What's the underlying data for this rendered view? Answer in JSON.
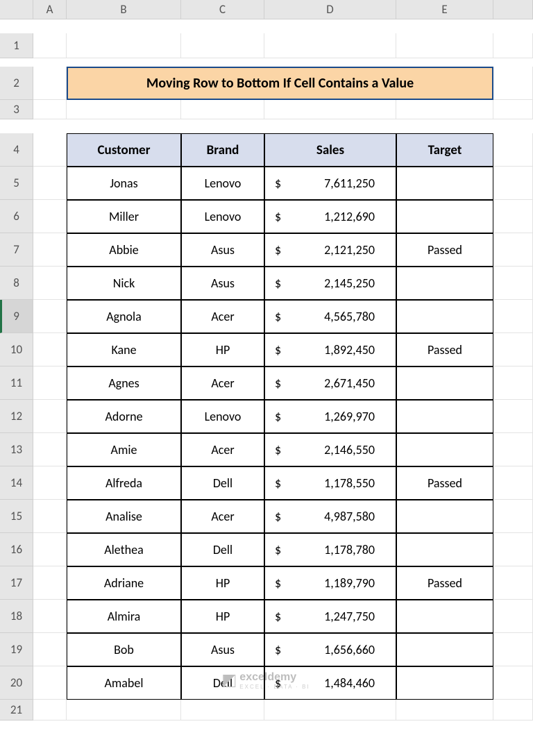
{
  "columns": [
    "A",
    "B",
    "C",
    "D",
    "E"
  ],
  "row_count": 21,
  "active_row": 9,
  "title": "Moving Row to Bottom If Cell Contains a Value",
  "headers": {
    "customer": "Customer",
    "brand": "Brand",
    "sales": "Sales",
    "target": "Target"
  },
  "currency_symbol": "$",
  "rows": [
    {
      "customer": "Jonas",
      "brand": "Lenovo",
      "sales": "7,611,250",
      "target": ""
    },
    {
      "customer": "Miller",
      "brand": "Lenovo",
      "sales": "1,212,690",
      "target": ""
    },
    {
      "customer": "Abbie",
      "brand": "Asus",
      "sales": "2,121,250",
      "target": "Passed"
    },
    {
      "customer": "Nick",
      "brand": "Asus",
      "sales": "2,145,250",
      "target": ""
    },
    {
      "customer": "Agnola",
      "brand": "Acer",
      "sales": "4,565,780",
      "target": ""
    },
    {
      "customer": "Kane",
      "brand": "HP",
      "sales": "1,892,450",
      "target": "Passed"
    },
    {
      "customer": "Agnes",
      "brand": "Acer",
      "sales": "2,671,450",
      "target": ""
    },
    {
      "customer": "Adorne",
      "brand": "Lenovo",
      "sales": "1,269,970",
      "target": ""
    },
    {
      "customer": "Amie",
      "brand": "Acer",
      "sales": "2,146,550",
      "target": ""
    },
    {
      "customer": "Alfreda",
      "brand": "Dell",
      "sales": "1,178,550",
      "target": "Passed"
    },
    {
      "customer": "Analise",
      "brand": "Acer",
      "sales": "4,987,580",
      "target": ""
    },
    {
      "customer": "Alethea",
      "brand": "Dell",
      "sales": "1,178,780",
      "target": ""
    },
    {
      "customer": "Adriane",
      "brand": "HP",
      "sales": "1,189,790",
      "target": "Passed"
    },
    {
      "customer": "Almira",
      "brand": "HP",
      "sales": "1,247,750",
      "target": ""
    },
    {
      "customer": "Bob",
      "brand": "Asus",
      "sales": "1,656,660",
      "target": ""
    },
    {
      "customer": "Amabel",
      "brand": "Dell",
      "sales": "1,484,460",
      "target": ""
    }
  ],
  "watermark": {
    "brand": "exceldemy",
    "tagline": "EXCEL · DATA · BI"
  },
  "chart_data": {
    "type": "table",
    "title": "Moving Row to Bottom If Cell Contains a Value",
    "columns": [
      "Customer",
      "Brand",
      "Sales",
      "Target"
    ],
    "data": [
      [
        "Jonas",
        "Lenovo",
        7611250,
        ""
      ],
      [
        "Miller",
        "Lenovo",
        1212690,
        ""
      ],
      [
        "Abbie",
        "Asus",
        2121250,
        "Passed"
      ],
      [
        "Nick",
        "Asus",
        2145250,
        ""
      ],
      [
        "Agnola",
        "Acer",
        4565780,
        ""
      ],
      [
        "Kane",
        "HP",
        1892450,
        "Passed"
      ],
      [
        "Agnes",
        "Acer",
        2671450,
        ""
      ],
      [
        "Adorne",
        "Lenovo",
        1269970,
        ""
      ],
      [
        "Amie",
        "Acer",
        2146550,
        ""
      ],
      [
        "Alfreda",
        "Dell",
        1178550,
        "Passed"
      ],
      [
        "Analise",
        "Acer",
        4987580,
        ""
      ],
      [
        "Alethea",
        "Dell",
        1178780,
        ""
      ],
      [
        "Adriane",
        "HP",
        1189790,
        "Passed"
      ],
      [
        "Almira",
        "HP",
        1247750,
        ""
      ],
      [
        "Bob",
        "Asus",
        1656660,
        ""
      ],
      [
        "Amabel",
        "Dell",
        1484460,
        ""
      ]
    ]
  }
}
